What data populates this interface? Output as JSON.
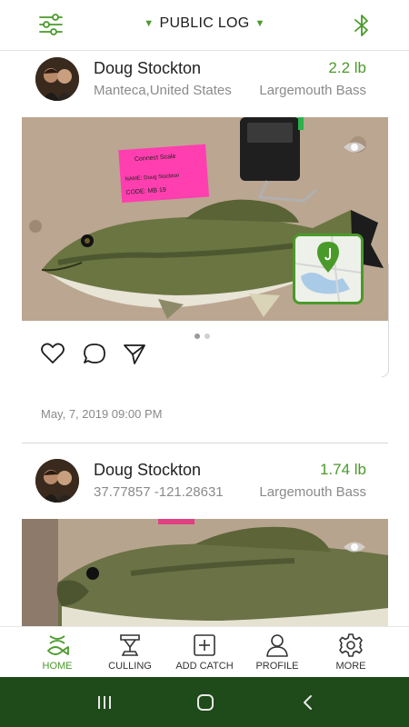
{
  "header": {
    "title": "PUBLIC LOG"
  },
  "posts": [
    {
      "name": "Doug Stockton",
      "location": "Manteca,United States",
      "weight": "2.2 lb",
      "species": "Largemouth Bass",
      "tag_brand": "Connect Scale",
      "tag_name": "NAME: Doug Stockton",
      "tag_code": "CODE: MB 19",
      "date": "May, 7, 2019 09:00 PM"
    },
    {
      "name": "Doug Stockton",
      "location": "37.77857 -121.28631",
      "weight": "1.74 lb",
      "species": "Largemouth Bass"
    }
  ],
  "nav": [
    {
      "label": "HOME",
      "active": true
    },
    {
      "label": "CULLING"
    },
    {
      "label": "ADD CATCH"
    },
    {
      "label": "PROFILE"
    },
    {
      "label": "MORE"
    }
  ],
  "colors": {
    "accent": "#4a9a2a",
    "system_bar": "#1f4a1a"
  }
}
